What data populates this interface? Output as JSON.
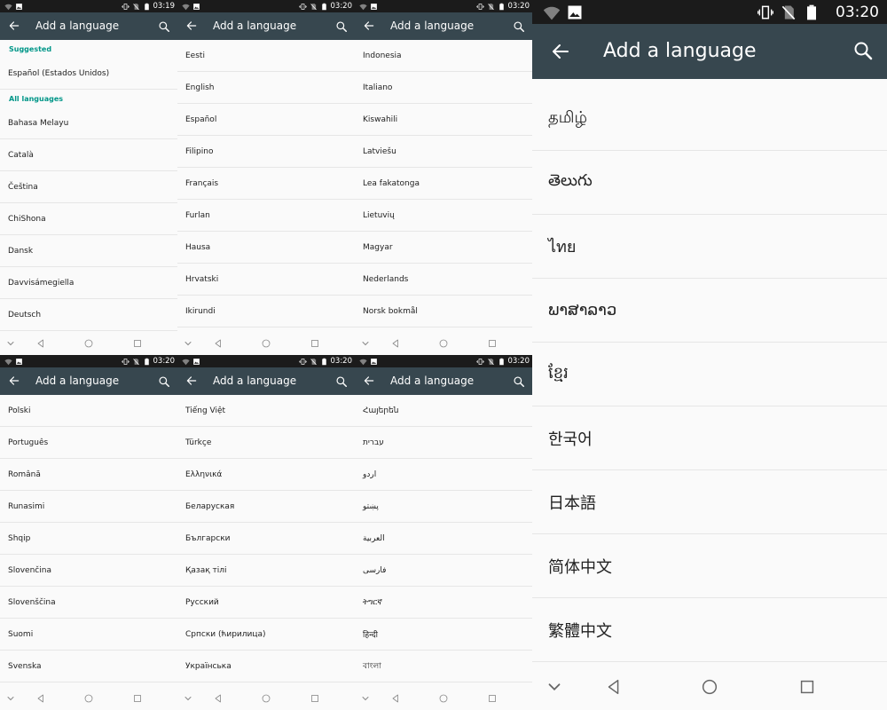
{
  "screen": {
    "title": "Add a language"
  },
  "panels": [
    {
      "id": "p1",
      "time": "03:19",
      "sections": [
        {
          "label": "Suggested",
          "items": [
            "Español (Estados Unidos)"
          ]
        },
        {
          "label": "All languages",
          "items": [
            "Bahasa Melayu",
            "Català",
            "Čeština",
            "ChiShona",
            "Dansk",
            "Davvisámegiella",
            "Deutsch"
          ]
        }
      ]
    },
    {
      "id": "p2",
      "time": "03:20",
      "sections": [
        {
          "label": "",
          "items": [
            "Eesti",
            "English",
            "Español",
            "Filipino",
            "Français",
            "Furlan",
            "Hausa",
            "Hrvatski",
            "Ikirundi"
          ]
        }
      ]
    },
    {
      "id": "p3",
      "time": "03:20",
      "sections": [
        {
          "label": "",
          "items": [
            "Indonesia",
            "Italiano",
            "Kiswahili",
            "Latviešu",
            "Lea fakatonga",
            "Lietuvių",
            "Magyar",
            "Nederlands",
            "Norsk bokmål"
          ]
        }
      ]
    },
    {
      "id": "p4",
      "time": "03:20",
      "sections": [
        {
          "label": "",
          "items": [
            "Polski",
            "Português",
            "Română",
            "Runasimi",
            "Shqip",
            "Slovenčina",
            "Slovenščina",
            "Suomi",
            "Svenska"
          ]
        }
      ]
    },
    {
      "id": "p5",
      "time": "03:20",
      "sections": [
        {
          "label": "",
          "items": [
            "Tiếng Việt",
            "Türkçe",
            "Ελληνικά",
            "Беларуская",
            "Български",
            "Қазақ тілі",
            "Русский",
            "Српски (ћирилица)",
            "Українська"
          ]
        }
      ]
    },
    {
      "id": "p6",
      "time": "03:20",
      "sections": [
        {
          "label": "",
          "items": [
            "Հայերեն",
            "עברית",
            "اردو",
            "پښتو",
            "العربية",
            "فارسی",
            "ትግርኛ",
            "हिन्दी",
            "বাংলা"
          ]
        }
      ]
    },
    {
      "id": "p7",
      "time": "03:20",
      "sections": [
        {
          "label": "",
          "items": [
            "தமிழ்",
            "తెలుగు",
            "ไทย",
            "ພາສາລາວ",
            "ខ្មែរ",
            "한국어",
            "日本語",
            "简体中文",
            "繁體中文"
          ]
        }
      ]
    }
  ],
  "icons": {
    "back": "arrow-back-icon",
    "search": "search-icon",
    "nav": [
      "chevron-down-icon",
      "back-triangle-icon",
      "home-circle-icon",
      "recents-square-icon"
    ],
    "status_left": [
      "wifi-icon",
      "image-icon"
    ],
    "status_right": [
      "vibrate-icon",
      "no-sim-icon",
      "battery-icon"
    ]
  },
  "colors": {
    "app_bar": "#37474f",
    "status_bar": "#1b1b1b",
    "section_accent": "#009688",
    "background": "#fafafa"
  }
}
